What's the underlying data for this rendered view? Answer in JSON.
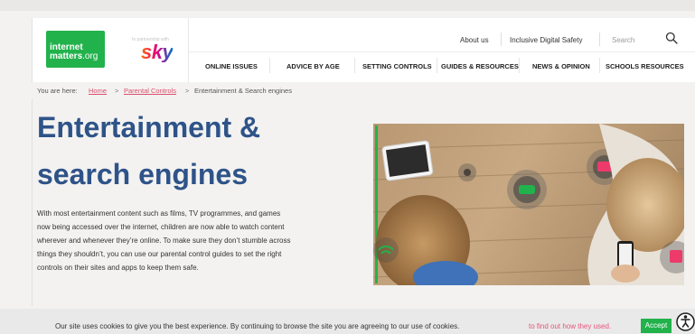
{
  "brand": {
    "logo_line1": "internet",
    "logo_line2": "matters",
    "logo_line2_suffix": ".org",
    "partner_text": "In partnership with",
    "partner_logo": "sky"
  },
  "utility_nav": {
    "about": "About us",
    "inclusive": "Inclusive Digital Safety",
    "search_placeholder": "Search",
    "search_icon": "search-icon"
  },
  "main_nav": {
    "items": [
      {
        "label": "ONLINE ISSUES"
      },
      {
        "label": "ADVICE BY AGE"
      },
      {
        "label": "SETTING CONTROLS"
      },
      {
        "label": "GUIDES & RESOURCES"
      },
      {
        "label": "NEWS & OPINION"
      },
      {
        "label": "SCHOOLS RESOURCES"
      }
    ]
  },
  "breadcrumb": {
    "prefix": "You are here:",
    "home": "Home",
    "parental": "Parental Controls",
    "current": "Entertainment & Search engines",
    "separator": ">"
  },
  "hero": {
    "title_line1": "Entertainment &",
    "title_line2": "search engines",
    "description_lines": [
      "With most entertainment content such as films, TV programmes, and games",
      "now being accessed over the internet, children are now able to watch content",
      "wherever and whenever they’re online. To make sure they don’t stumble across",
      "things they shouldn’t, you can use our parental control guides to set the right",
      "controls on their sites and apps to keep them safe."
    ]
  },
  "cookie_bar": {
    "text": "Our site uses cookies to give you the best experience. By continuing to browse the site you are agreeing to our use of cookies.",
    "link": "to find out how they used.",
    "accept": "Accept",
    "accessibility_icon": "accessibility-icon"
  },
  "colors": {
    "brand_green": "#22b24c",
    "title_blue": "#2e5389",
    "link_pink": "#d94f6c"
  }
}
